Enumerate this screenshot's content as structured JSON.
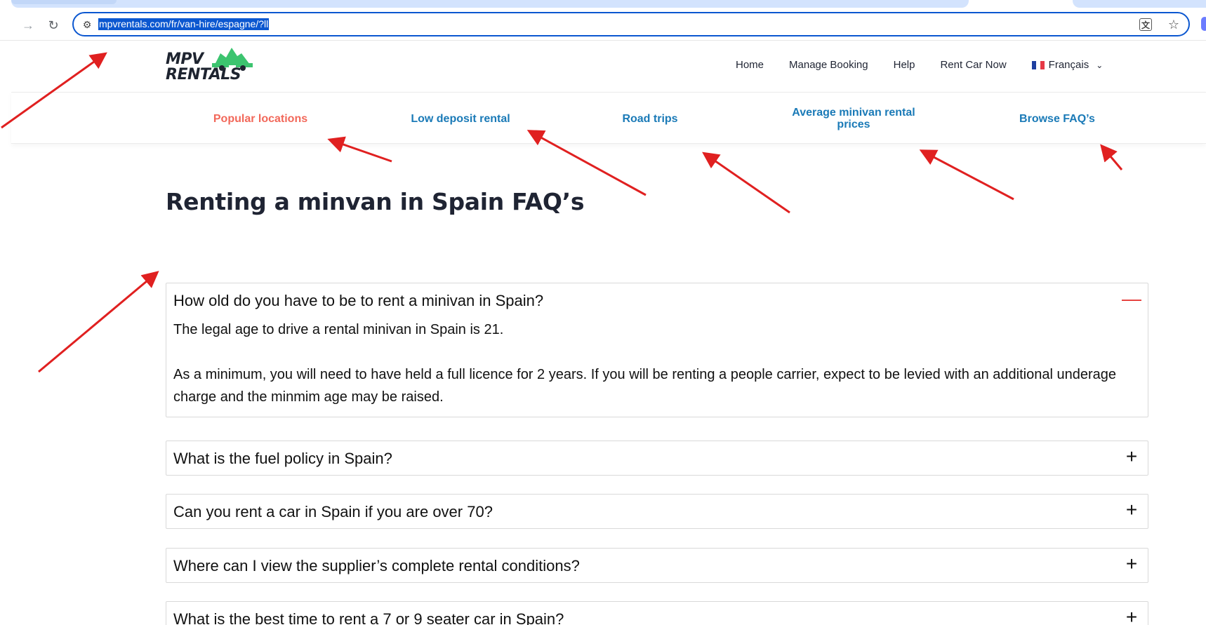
{
  "browser": {
    "url": "mpvrentals.com/fr/van-hire/espagne/?ll",
    "icons": {
      "forward": "arrow-forward-icon",
      "reload": "reload-icon",
      "site_info": "site-info-icon",
      "translate": "translate-icon",
      "bookmark": "star-icon"
    }
  },
  "header": {
    "logo_top": "MPV",
    "logo_bottom": "RENTALS",
    "nav": [
      "Home",
      "Manage Booking",
      "Help",
      "Rent Car Now"
    ],
    "language": "Français"
  },
  "sub_nav": {
    "items": [
      "Popular locations",
      "Low deposit rental",
      "Road trips",
      "Average minivan rental prices",
      "Browse FAQ’s"
    ],
    "active_index": 0
  },
  "content": {
    "title": "Renting a minvan in Spain FAQ’s",
    "faqs": [
      {
        "question": "How old do you have to be to rent a minivan in Spain?",
        "expanded": true,
        "answer": [
          "The legal age to drive a rental minivan in Spain is 21.",
          "As a minimum, you will need to have held a full licence for 2 years. If you will be renting a people carrier, expect to be levied with an additional underage charge and the minmim age may be raised."
        ]
      },
      {
        "question": "What is the fuel policy in Spain?",
        "expanded": false
      },
      {
        "question": "Can you rent a car in Spain if you are over 70?",
        "expanded": false
      },
      {
        "question": "Where can I view the supplier’s complete rental conditions?",
        "expanded": false
      },
      {
        "question": "What is the best time to rent a 7 or 9 seater car in Spain?",
        "expanded": false
      }
    ]
  },
  "colors": {
    "accent_blue": "#1a7ab7",
    "active_link": "#f2685a",
    "logo_green": "#3cc46f",
    "annotation_red": "#e02020",
    "omnibox_border": "#0b57d0"
  }
}
